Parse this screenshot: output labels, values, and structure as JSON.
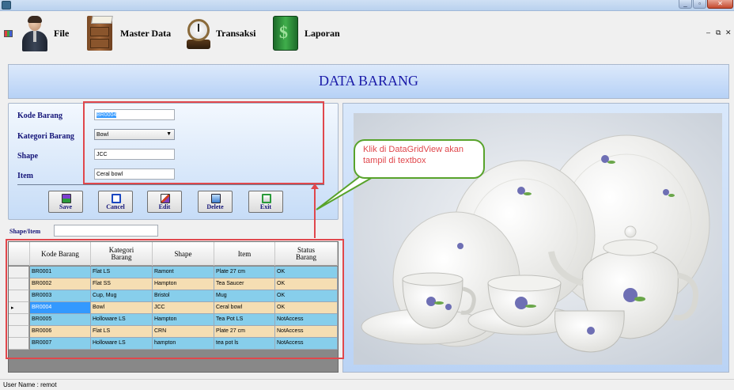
{
  "menu": {
    "file": "File",
    "master_data": "Master Data",
    "transaksi": "Transaksi",
    "laporan": "Laporan"
  },
  "window_controls": [
    "_",
    "▫",
    "✕"
  ],
  "mdi_controls": [
    "–",
    "⧉",
    "✕"
  ],
  "page_title": "DATA BARANG",
  "form": {
    "kode_barang_label": "Kode Barang",
    "kode_barang_value": "BR0004",
    "kategori_label": "Kategori Barang",
    "kategori_value": "Bowl",
    "shape_label": "Shape",
    "shape_value": "JCC",
    "item_label": "Item",
    "item_value": "Ceral bowl"
  },
  "buttons": {
    "save": "Save",
    "cancel": "Cancel",
    "edit": "Edit",
    "delete": "Delete",
    "exit": "Exit"
  },
  "search": {
    "label": "Shape/Item",
    "value": ""
  },
  "grid": {
    "columns": [
      "Kode Barang",
      "Kategori\nBarang",
      "Shape",
      "Item",
      "Status\nBarang"
    ],
    "rows": [
      {
        "kode": "BR0001",
        "kategori": "Flat LS",
        "shape": "Ramont",
        "item": "Plate 27 cm",
        "status": "OK",
        "selected": false
      },
      {
        "kode": "BR0002",
        "kategori": "Flat SS",
        "shape": "Hampton",
        "item": "Tea Saucer",
        "status": "OK",
        "selected": false
      },
      {
        "kode": "BR0003",
        "kategori": "Cup, Mug",
        "shape": "Bristol",
        "item": "Mug",
        "status": "OK",
        "selected": false
      },
      {
        "kode": "BR0004",
        "kategori": "Bowl",
        "shape": "JCC",
        "item": "Ceral bowl",
        "status": "OK",
        "selected": true
      },
      {
        "kode": "BR0005",
        "kategori": "Holloware LS",
        "shape": "Hampton",
        "item": "Tea Pot LS",
        "status": "NotAccess",
        "selected": false
      },
      {
        "kode": "BR0006",
        "kategori": "Flat LS",
        "shape": "CRN",
        "item": "Plate 27 cm",
        "status": "NotAccess",
        "selected": false
      },
      {
        "kode": "BR0007",
        "kategori": "Holloware LS",
        "shape": "hampton",
        "item": "tea pot ls",
        "status": "NotAccess",
        "selected": false
      }
    ],
    "current_row_marker": "▸",
    "row_colors": [
      "#87ceeb",
      "#f5deb3"
    ],
    "selected_color": "#3399ff"
  },
  "callout_text": "Klik di DataGridView akan tampil di textbox",
  "status_bar": "User Name :  remot",
  "colors": {
    "title_text": "#1a1aa8",
    "label_text": "#141478",
    "annotation_red": "#e0474c",
    "callout_border": "#58a32b"
  }
}
